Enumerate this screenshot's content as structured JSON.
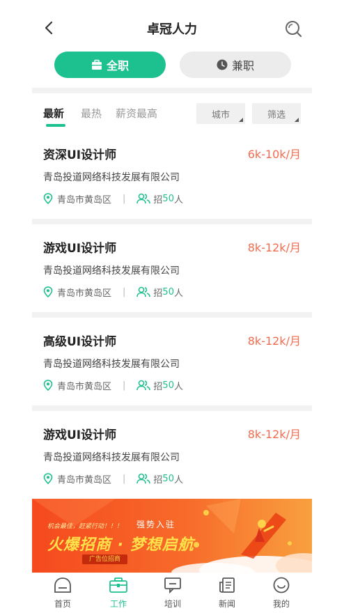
{
  "header": {
    "title": "卓冠人力",
    "back_icon": "chevron-left-icon",
    "search_icon": "search-icon"
  },
  "segments": {
    "full_time": "全职",
    "part_time": "兼职"
  },
  "sort_tabs": [
    "最新",
    "最热",
    "薪资最高"
  ],
  "filters": {
    "city": "城市",
    "filter": "筛选"
  },
  "jobs": [
    {
      "title": "资深UI设计师",
      "salary": "6k-10k/月",
      "company": "青岛投道网络科技发展有限公司",
      "location": "青岛市黄岛区",
      "recruit_prefix": "招",
      "recruit_count": "50",
      "recruit_suffix": "人"
    },
    {
      "title": "游戏UI设计师",
      "salary": "8k-12k/月",
      "company": "青岛投道网络科技发展有限公司",
      "location": "青岛市黄岛区",
      "recruit_prefix": "招",
      "recruit_count": "50",
      "recruit_suffix": "人"
    },
    {
      "title": "高级UI设计师",
      "salary": "8k-12k/月",
      "company": "青岛投道网络科技发展有限公司",
      "location": "青岛市黄岛区",
      "recruit_prefix": "招",
      "recruit_count": "50",
      "recruit_suffix": "人"
    },
    {
      "title": "游戏UI设计师",
      "salary": "8k-12k/月",
      "company": "青岛投道网络科技发展有限公司",
      "location": "青岛市黄岛区",
      "recruit_prefix": "招",
      "recruit_count": "50",
      "recruit_suffix": "人"
    }
  ],
  "banner": {
    "top_text": "机会最佳，赶紧行动！！！",
    "mid_text": "强势入驻",
    "headline": "火爆招商 · 梦想启航",
    "badge": "广告位招商"
  },
  "tabbar": [
    {
      "label": "首页",
      "icon": "home-icon"
    },
    {
      "label": "工作",
      "icon": "briefcase-icon"
    },
    {
      "label": "培训",
      "icon": "chat-icon"
    },
    {
      "label": "新闻",
      "icon": "news-icon"
    },
    {
      "label": "我的",
      "icon": "smile-icon"
    }
  ],
  "colors": {
    "accent": "#1dc08f",
    "salary": "#f36b4e"
  }
}
